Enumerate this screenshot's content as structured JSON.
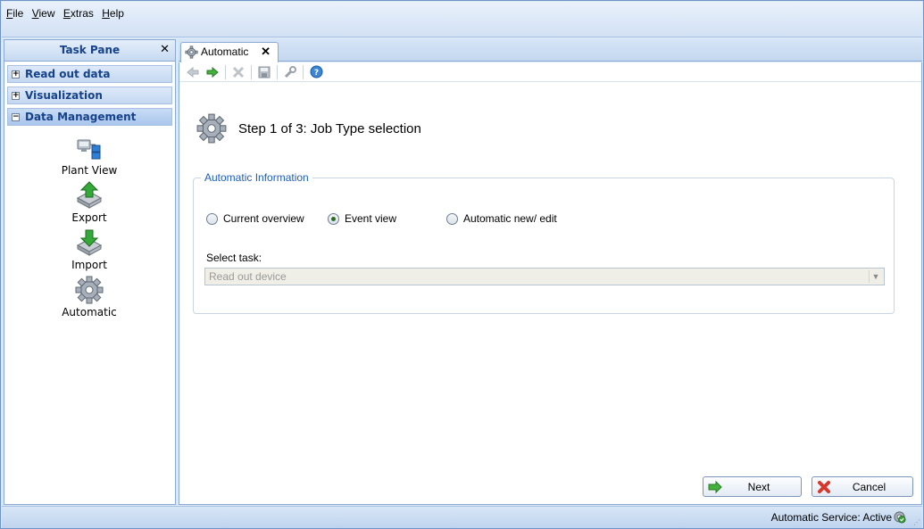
{
  "menu": {
    "items": [
      {
        "accel": "F",
        "rest": "ile"
      },
      {
        "accel": "V",
        "rest": "iew"
      },
      {
        "accel": "E",
        "rest": "xtras"
      },
      {
        "accel": "H",
        "rest": "elp"
      }
    ]
  },
  "task_pane": {
    "title": "Task Pane",
    "close_glyph": "✕",
    "sections": [
      {
        "label": "Read out data",
        "expanded": false,
        "glyph": "+"
      },
      {
        "label": "Visualization",
        "expanded": false,
        "glyph": "+"
      },
      {
        "label": "Data Management",
        "expanded": true,
        "glyph": "−"
      }
    ],
    "items": [
      {
        "label": "Plant View",
        "icon": "plant-view-icon"
      },
      {
        "label": "Export",
        "icon": "export-icon"
      },
      {
        "label": "Import",
        "icon": "import-icon"
      },
      {
        "label": "Automatic",
        "icon": "gear-icon"
      }
    ]
  },
  "tab": {
    "label": "Automatic",
    "close_glyph": "✕",
    "icon": "gear-icon"
  },
  "toolbar": {
    "buttons": [
      "back-arrow-icon",
      "forward-arrow-icon",
      "delete-icon",
      "save-icon",
      "wrench-icon",
      "help-icon"
    ]
  },
  "step": {
    "title": "Step 1 of 3: Job Type selection",
    "icon": "gear-icon"
  },
  "group": {
    "legend": "Automatic Information",
    "radios": [
      {
        "label": "Current overview",
        "checked": false
      },
      {
        "label": "Event view",
        "checked": true
      },
      {
        "label": "Automatic new/ edit",
        "checked": false
      }
    ],
    "select_label": "Select task:",
    "select_value": "Read out device"
  },
  "buttons": {
    "next": "Next",
    "cancel": "Cancel"
  },
  "status": {
    "text": "Automatic Service: Active"
  },
  "colors": {
    "accent": "#15428b",
    "legend": "#1f5fb9",
    "green": "#3aa23a",
    "red": "#d6382b"
  }
}
